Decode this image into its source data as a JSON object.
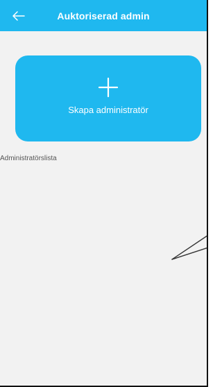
{
  "app_bar": {
    "title": "Auktoriserad admin",
    "back_icon": "arrow-left-icon",
    "background": "#1fb8ef",
    "text_color": "#ffffff"
  },
  "create_card": {
    "label": "Skapa administratör",
    "icon": "plus-icon",
    "background": "#1fb8ef",
    "text_color": "#ffffff"
  },
  "list_section": {
    "label": "Administratörslista"
  },
  "page": {
    "background": "#f2f2f2",
    "border_color": "#111111"
  }
}
